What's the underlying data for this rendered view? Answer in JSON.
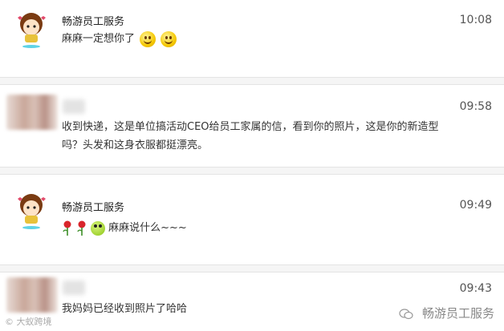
{
  "messages": [
    {
      "sender": "畅游员工服务",
      "time": "10:08",
      "text": "麻麻一定想你了",
      "emojis": [
        "smiley-icon",
        "smiley-icon"
      ]
    },
    {
      "sender": "",
      "time": "09:58",
      "text": "收到快递，这是单位搞活动CEO给员工家属的信，看到你的照片，这是你的新造型吗？头发和这身衣服都挺漂亮。"
    },
    {
      "sender": "畅游员工服务",
      "time": "09:49",
      "text": "麻麻说什么~~~",
      "emojis": [
        "rose-icon",
        "rose-icon",
        "frog-icon"
      ]
    },
    {
      "sender": "",
      "time": "09:43",
      "text": "我妈妈已经收到照片了哈哈"
    }
  ],
  "watermark": {
    "left_text": "大蚁跨境",
    "right_text": "畅游员工服务"
  },
  "colors": {
    "divider": "#f5f5f5",
    "rose": "#d9262c",
    "smiley": "#f5c800"
  }
}
